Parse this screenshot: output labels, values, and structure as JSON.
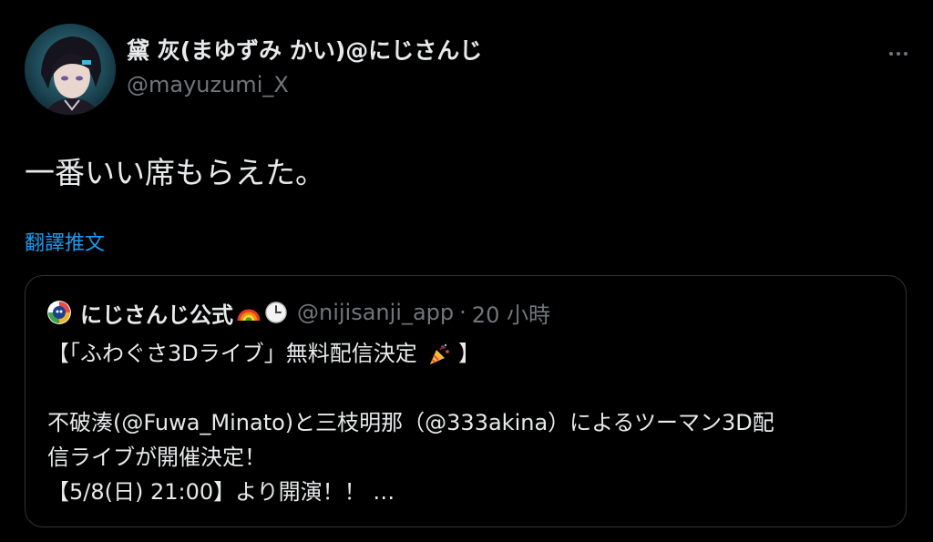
{
  "tweet": {
    "author": {
      "display_name": "黛 灰(まゆずみ かい)@にじさんじ",
      "handle": "@mayuzumi_X"
    },
    "text": "一番いい席もらえた。",
    "translate_label": "翻譯推文",
    "more_icon": "more-horizontal-icon"
  },
  "quote": {
    "author": {
      "display_name": "にじさんじ公式",
      "emoji": [
        "rainbow-icon",
        "clock-icon"
      ],
      "handle": "@nijisanji_app",
      "separator": "·",
      "time": "20 小時"
    },
    "lines": [
      "【「ふわぐさ3Dライブ」無料配信決定",
      "】",
      "不破湊(@Fuwa_Minato)と三枝明那（@333akina）によるツーマン3D配",
      "信ライブが開催決定！",
      "【5/8(日) 21:00】より開演！！ …"
    ]
  },
  "colors": {
    "background": "#000000",
    "text_primary": "#e7e9ea",
    "text_secondary": "#71767b",
    "link": "#1d9bf0",
    "border": "#2f3336"
  }
}
